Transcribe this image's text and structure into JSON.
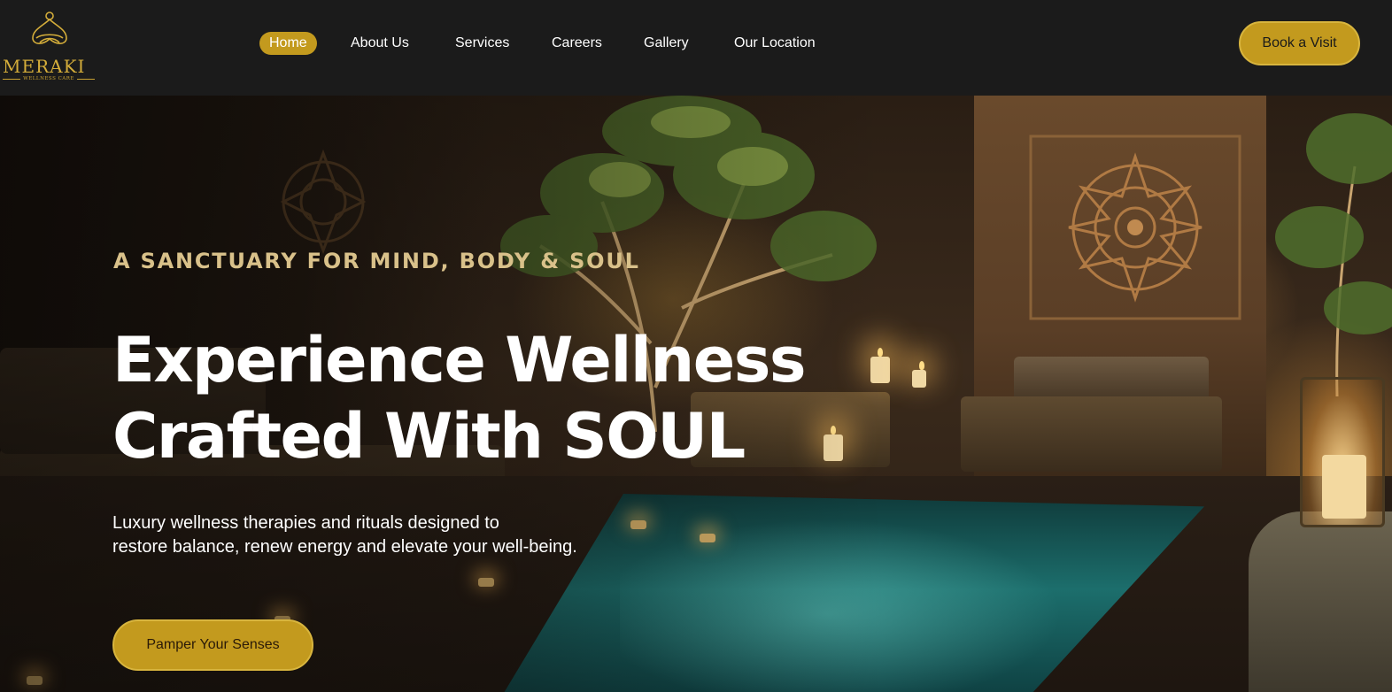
{
  "brand": {
    "name": "MERAKI",
    "tagline": "WELLNESS CARE",
    "logo_icon": "lotus-knot-icon",
    "gold": "#c39a1e"
  },
  "nav": {
    "items": [
      {
        "label": "Home",
        "active": true
      },
      {
        "label": "About Us",
        "active": false
      },
      {
        "label": "Services",
        "active": false
      },
      {
        "label": "Careers",
        "active": false
      },
      {
        "label": "Gallery",
        "active": false
      },
      {
        "label": "Our Location",
        "active": false
      }
    ],
    "cta_label": "Book a Visit"
  },
  "hero": {
    "eyebrow": "A SANCTUARY FOR MIND, BODY & SOUL",
    "headline_line1": "Experience Wellness",
    "headline_line2": "Crafted With SOUL",
    "subtext_line1": "Luxury wellness therapies and rituals designed to",
    "subtext_line2": "restore balance, renew energy and elevate your well-being.",
    "cta_label": "Pamper Your Senses"
  }
}
